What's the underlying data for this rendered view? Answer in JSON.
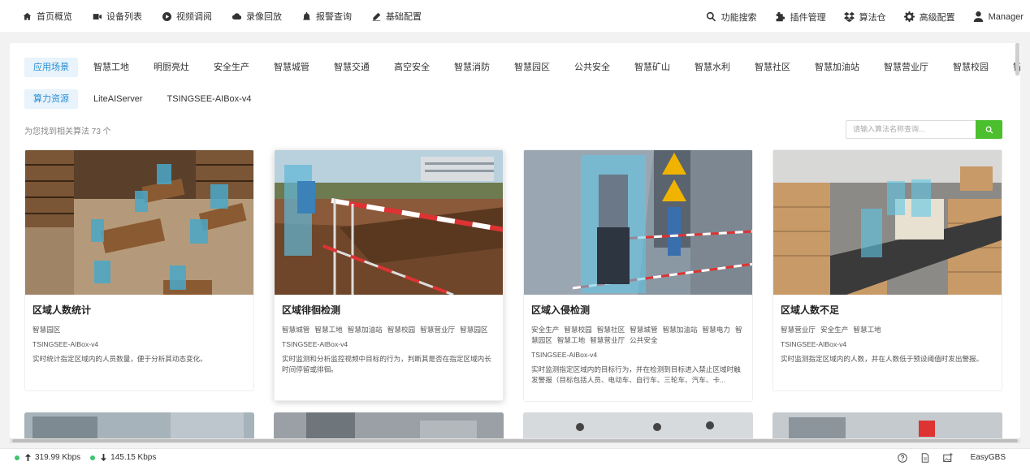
{
  "nav": {
    "left": [
      {
        "label": "首页概览",
        "icon": "home-icon"
      },
      {
        "label": "设备列表",
        "icon": "video-camera-icon"
      },
      {
        "label": "视频调阅",
        "icon": "play-circle-icon"
      },
      {
        "label": "录像回放",
        "icon": "cloud-icon"
      },
      {
        "label": "报警查询",
        "icon": "alarm-icon"
      },
      {
        "label": "基础配置",
        "icon": "pencil-icon"
      }
    ],
    "right": [
      {
        "label": "功能搜索",
        "icon": "search-icon"
      },
      {
        "label": "插件管理",
        "icon": "puzzle-icon"
      },
      {
        "label": "算法仓",
        "icon": "dropbox-icon"
      },
      {
        "label": "高级配置",
        "icon": "gear-icon"
      },
      {
        "label": "Manager",
        "icon": "user-icon"
      }
    ]
  },
  "scenes": [
    "应用场景",
    "智慧工地",
    "明厨亮灶",
    "安全生产",
    "智慧城管",
    "智慧交通",
    "高空安全",
    "智慧消防",
    "智慧园区",
    "公共安全",
    "智慧矿山",
    "智慧水利",
    "智慧社区",
    "智慧加油站",
    "智慧营业厅",
    "智慧校园",
    "智慧电力"
  ],
  "compute": [
    "算力资源",
    "LiteAIServer",
    "TSINGSEE-AIBox-v4"
  ],
  "found_text": "为您找到相关算法 73 个",
  "search": {
    "placeholder": "请输入算法名称查询..."
  },
  "cards": [
    {
      "title": "区域人数统计",
      "tags": [
        "智慧园区"
      ],
      "server": "TSINGSEE-AIBox-v4",
      "desc": "实时统计指定区域内的人员数量，便于分析其动态变化。"
    },
    {
      "title": "区域徘徊检测",
      "tags": [
        "智慧城管",
        "智慧工地",
        "智慧加油站",
        "智慧校园",
        "智慧营业厅",
        "智慧园区"
      ],
      "server": "TSINGSEE-AIBox-v4",
      "desc": "实时监测和分析监控视频中目标的行为，判断其是否在指定区域内长时间停留或徘徊。"
    },
    {
      "title": "区域入侵检测",
      "tags": [
        "安全生产",
        "智慧校园",
        "智慧社区",
        "智慧城管",
        "智慧加油站",
        "智慧电力",
        "智慧园区",
        "智慧工地",
        "智慧营业厅",
        "公共安全"
      ],
      "server": "TSINGSEE-AIBox-v4",
      "desc": "实时监测指定区域内的目标行为，并在检测到目标进入禁止区域时触发警报（目标包括人员、电动车、自行车、三轮车、汽车、卡..."
    },
    {
      "title": "区域人数不足",
      "tags": [
        "智慧营业厅",
        "安全生产",
        "智慧工地"
      ],
      "server": "TSINGSEE-AIBox-v4",
      "desc": "实时监测指定区域内的人数，并在人数低于预设阈值时发出警报。"
    }
  ],
  "status": {
    "upload": "319.99 Kbps",
    "download": "145.15 Kbps",
    "brand": "EasyGBS"
  },
  "colors": {
    "accent": "#2a8fd6",
    "accent_bg": "#e8f3fb",
    "search_btn": "#4bbf2e",
    "online": "#3ec46d"
  }
}
